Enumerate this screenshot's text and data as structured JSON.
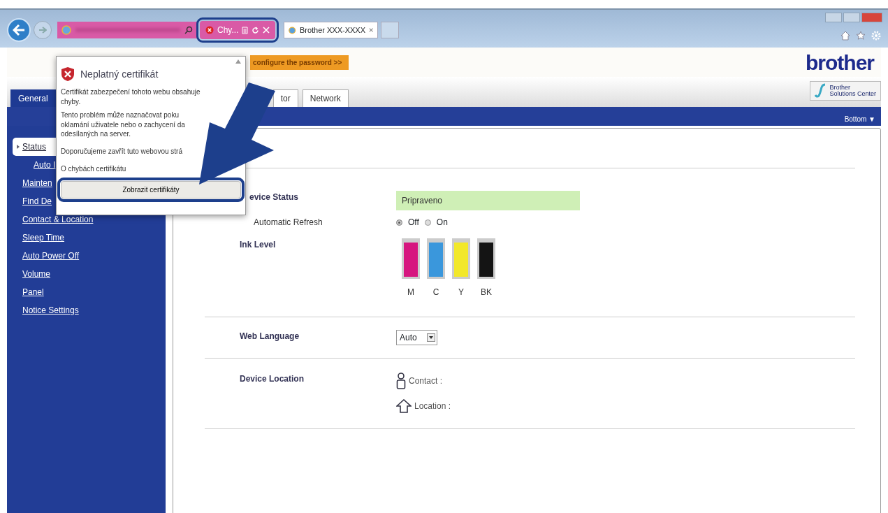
{
  "browser": {
    "security_indicator": {
      "label": "Chy...",
      "highlighted": true
    },
    "tabs": [
      {
        "title": "Brother XXX-XXXX",
        "selected": true
      }
    ]
  },
  "page": {
    "banner": "configure the password >>",
    "logo": "brother",
    "solutions_button": {
      "line_1": "Brother",
      "line_2": "Solutions Center"
    },
    "tabs": [
      {
        "label": "General",
        "selected": true
      },
      {
        "label": "tor",
        "selected": false
      },
      {
        "label": "Network",
        "selected": false
      }
    ],
    "bottom_link": "Bottom ▼",
    "sidebar": {
      "items": [
        {
          "label": "Status",
          "selected": true,
          "kind": "section"
        },
        {
          "label": "Auto I",
          "selected": false,
          "kind": "sub"
        },
        {
          "label": "Mainten",
          "selected": false,
          "kind": "section"
        },
        {
          "label": "Find De",
          "selected": false,
          "kind": "section"
        },
        {
          "label": "Contact & Location",
          "selected": false,
          "kind": "section"
        },
        {
          "label": "Sleep Time",
          "selected": false,
          "kind": "section"
        },
        {
          "label": "Auto Power Off",
          "selected": false,
          "kind": "section"
        },
        {
          "label": "Volume",
          "selected": false,
          "kind": "section"
        },
        {
          "label": "Panel",
          "selected": false,
          "kind": "section"
        },
        {
          "label": "Notice Settings",
          "selected": false,
          "kind": "section"
        }
      ]
    },
    "content": {
      "device_status": {
        "label": "evice Status",
        "value": "Pripraveno"
      },
      "automatic_refresh": {
        "label": "Automatic Refresh",
        "options": [
          {
            "label": "Off",
            "selected": true
          },
          {
            "label": "On",
            "selected": false
          }
        ]
      },
      "ink_level": {
        "label": "Ink Level",
        "cartridges": [
          {
            "label": "M",
            "color": "#d6167f",
            "level": 0.95
          },
          {
            "label": "C",
            "color": "#3a97dc",
            "level": 0.95
          },
          {
            "label": "Y",
            "color": "#f2e82a",
            "level": 0.95
          },
          {
            "label": "BK",
            "color": "#141414",
            "level": 0.95
          }
        ]
      },
      "web_language": {
        "label": "Web Language",
        "value": "Auto"
      },
      "device_location": {
        "label": "Device Location",
        "fields": [
          {
            "kind": "contact",
            "label": "Contact :"
          },
          {
            "kind": "location",
            "label": "Location :"
          }
        ]
      }
    }
  },
  "certificate_popup": {
    "title": "Neplatný certifikát",
    "paragraphs": [
      "Certifikát zabezpečení tohoto webu obsahuje\nchyby.",
      "Tento problém může naznačovat poku\noklamání uživatele nebo o zachycení da\nodesílaných na server."
    ],
    "links": [
      "Doporučujeme zavřít tuto webovou strá",
      "O chybách certifikátu"
    ],
    "button": {
      "label": "Zobrazit certifikáty",
      "highlighted": true
    }
  }
}
